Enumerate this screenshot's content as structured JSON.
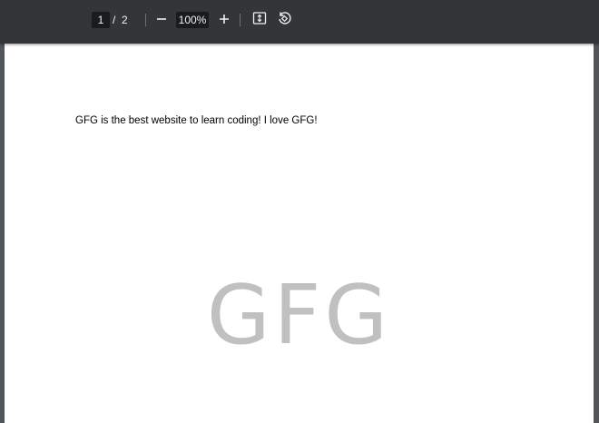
{
  "toolbar": {
    "current_page": "1",
    "page_separator": "/",
    "total_pages": "2",
    "zoom_level": "100%",
    "icons": {
      "zoom_out": "minus-icon",
      "zoom_in": "plus-icon",
      "fit": "fit-to-page-icon",
      "rotate": "rotate-icon"
    },
    "background_color": "#323639"
  },
  "document": {
    "body_text": "GFG is the best website to learn coding! I love GFG!",
    "watermark_text": "GFG",
    "watermark_color": "#c0c0c0",
    "page_color": "#ffffff",
    "viewer_background": "#525659"
  }
}
